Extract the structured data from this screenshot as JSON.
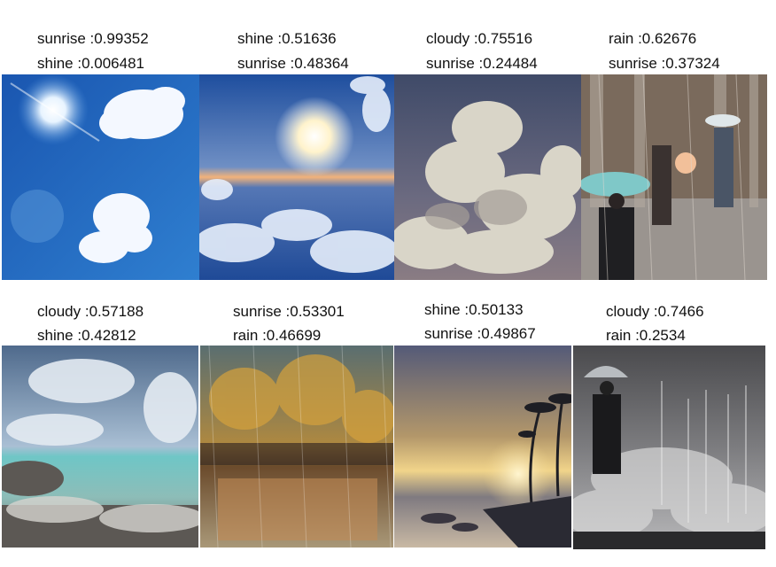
{
  "figure": {
    "panels": [
      {
        "top_label": "sunrise :0.99352",
        "bottom_label": "shine :0.006481",
        "scene": "bright sun in blue sky with white clouds"
      },
      {
        "top_label": "shine :0.51636",
        "bottom_label": "sunrise :0.48364",
        "scene": "sun above sea of clouds"
      },
      {
        "top_label": "cloudy :0.75516",
        "bottom_label": "sunrise :0.24484",
        "scene": "large cumulus clouds"
      },
      {
        "top_label": "rain :0.62676",
        "bottom_label": "sunrise :0.37324",
        "scene": "people with umbrellas in rainy street"
      },
      {
        "top_label": "cloudy :0.57188",
        "bottom_label": "shine :0.42812",
        "scene": "clouds over turquoise sea"
      },
      {
        "top_label": "sunrise :0.53301",
        "bottom_label": "rain :0.46699",
        "scene": "rainy street with warm lights"
      },
      {
        "top_label": "shine :0.50133",
        "bottom_label": "sunrise :0.49867",
        "scene": "sunset beach with palm trees"
      },
      {
        "top_label": "cloudy :0.7466",
        "bottom_label": "rain :0.2534",
        "scene": "person with umbrella in heavy grey rain"
      }
    ]
  }
}
